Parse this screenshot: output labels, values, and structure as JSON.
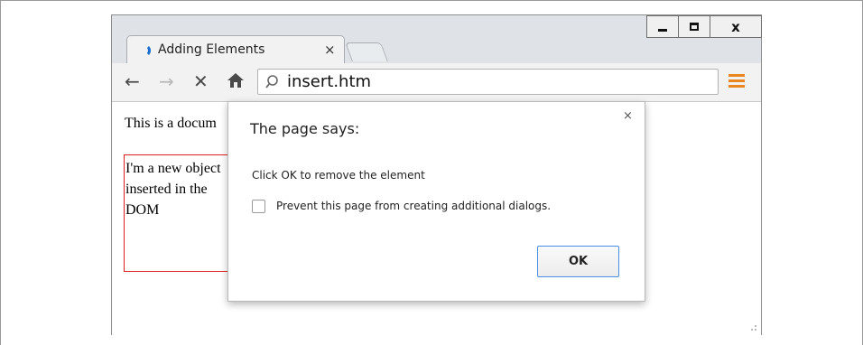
{
  "window": {
    "minimize_icon": "minimize-icon",
    "maximize_icon": "maximize-icon",
    "close_label": "x"
  },
  "tab": {
    "title": "Adding Elements",
    "close_label": "×",
    "favicon": "loading-spinner-icon",
    "accent": "#1b6fcf"
  },
  "toolbar": {
    "back_label": "←",
    "forward_label": "→",
    "stop_label": "✕",
    "home_label": "🏠",
    "url": "insert.htm",
    "menu_color": "#e8871e"
  },
  "page": {
    "doc_text": "This is a docum",
    "new_box_text": "I'm a new object inserted in the DOM",
    "new_box_border": "#e02020"
  },
  "dialog": {
    "title": "The page says:",
    "close_label": "×",
    "message": "Click OK to remove the element",
    "checkbox_label": "Prevent this page from creating additional dialogs.",
    "checkbox_checked": false,
    "ok_label": "OK",
    "ok_border": "#4a90e2"
  }
}
